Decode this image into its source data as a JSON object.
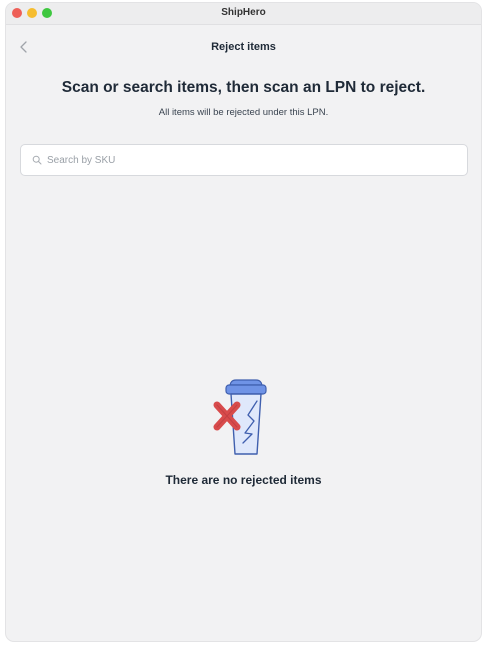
{
  "window": {
    "title": "ShipHero"
  },
  "navbar": {
    "title": "Reject items",
    "back_icon": "chevron-left-icon"
  },
  "instructions": {
    "headline": "Scan or search items, then scan an LPN to reject.",
    "subline": "All items will be rejected under this LPN."
  },
  "search": {
    "placeholder": "Search by SKU",
    "value": "",
    "icon": "search-icon"
  },
  "empty_state": {
    "message": "There are no rejected items",
    "icon": "broken-cup-reject-icon"
  },
  "colors": {
    "traffic_red": "#ee5f57",
    "traffic_yellow": "#f6bd2f",
    "traffic_green": "#3ec73f",
    "illustration_blue": "#6f93e6",
    "illustration_red": "#d84b4b"
  }
}
